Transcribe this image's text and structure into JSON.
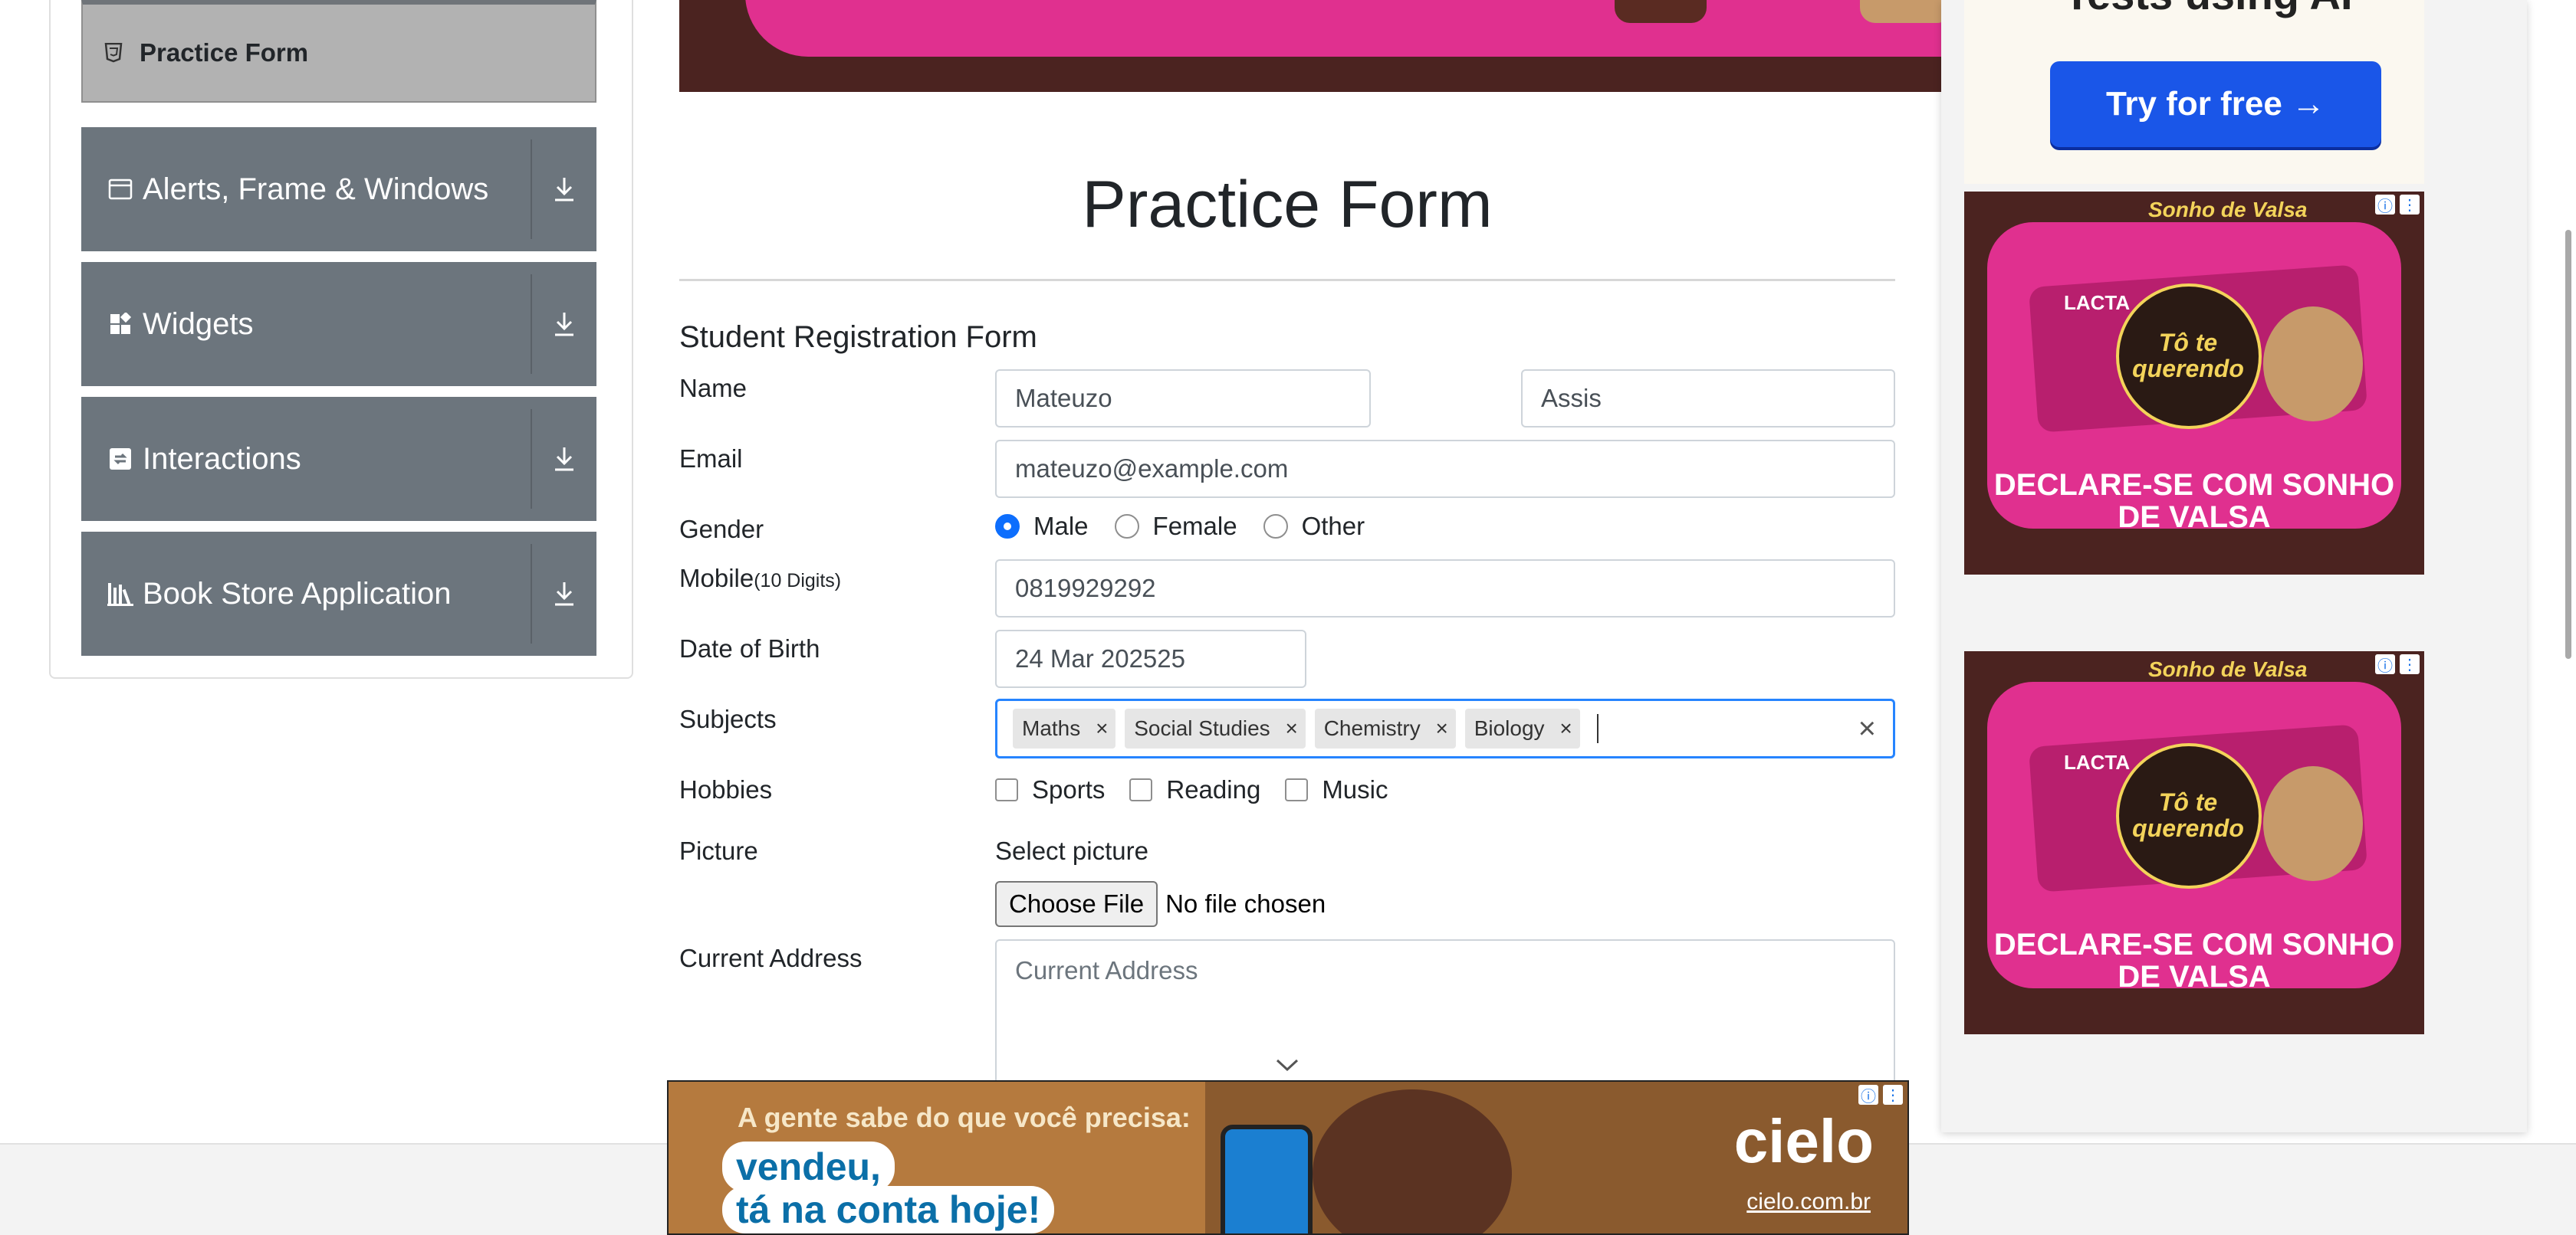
{
  "sidebar": {
    "active_item": {
      "label": "Practice Form",
      "icon": "html5-icon"
    },
    "groups": [
      {
        "label": "Alerts, Frame & Windows",
        "icon": "window-icon"
      },
      {
        "label": "Widgets",
        "icon": "widgets-icon"
      },
      {
        "label": "Interactions",
        "icon": "interactions-icon"
      },
      {
        "label": "Book Store Application",
        "icon": "library-icon"
      }
    ]
  },
  "main": {
    "page_title": "Practice Form",
    "form_heading": "Student Registration Form",
    "labels": {
      "name": "Name",
      "email": "Email",
      "gender": "Gender",
      "mobile": "Mobile",
      "mobile_hint": "(10 Digits)",
      "dob": "Date of Birth",
      "subjects": "Subjects",
      "hobbies": "Hobbies",
      "picture": "Picture",
      "current_address": "Current Address"
    },
    "first_name": "Mateuzo",
    "last_name": "Assis",
    "email": "mateuzo@example.com",
    "gender_options": [
      "Male",
      "Female",
      "Other"
    ],
    "gender_selected": "Male",
    "mobile": "0819929292",
    "dob": "24 Mar 202525",
    "subjects": [
      "Maths",
      "Social Studies",
      "Chemistry",
      "Biology"
    ],
    "hobbies": [
      "Sports",
      "Reading",
      "Music"
    ],
    "select_picture": "Select picture",
    "choose_file": "Choose File",
    "no_file": "No file chosen",
    "address_placeholder": "Current Address"
  },
  "ads": {
    "top_text": "Tests using AI",
    "try_button": "Try for free →",
    "chocolate_brand": "Sonho de Valsa",
    "chocolate_maker": "LACTA",
    "chocolate_circle": "Tô te querendo",
    "chocolate_slogan": "DECLARE-SE COM SONHO DE VALSA",
    "bottom_tagline": "A gente sabe do que você precisa:",
    "bottom_line1": "vendeu,",
    "bottom_line2": "tá na conta hoje!",
    "bottom_brand": "cielo",
    "bottom_url": "cielo.com.br"
  }
}
